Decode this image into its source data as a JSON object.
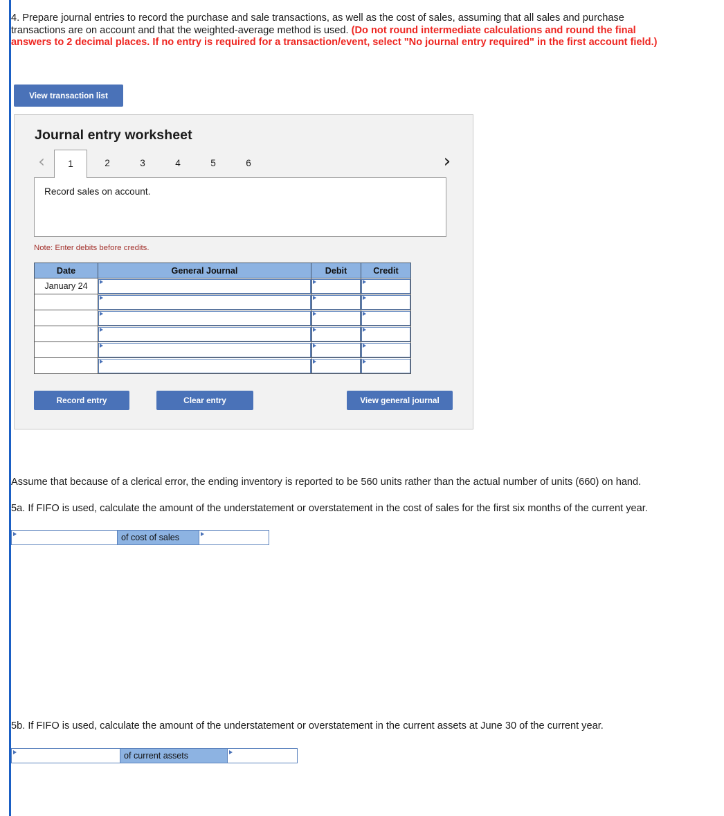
{
  "question4": {
    "plain_1": "4. Prepare journal entries to record the purchase and sale transactions, as well as the cost of sales, assuming that all sales and purchase transactions are on account and that the weighted-average method is used. ",
    "red_note": "(Do not round intermediate calculations and round the final answers to 2 decimal places. If no entry is required for a transaction/event, select \"No journal entry required\" in the first account field.)"
  },
  "buttons": {
    "view_transaction_list": "View transaction list",
    "record_entry": "Record entry",
    "clear_entry": "Clear entry",
    "view_general_journal": "View general journal"
  },
  "worksheet": {
    "title": "Journal entry worksheet",
    "prev_icon": "chevron-left",
    "next_icon": "chevron-right",
    "tabs": [
      {
        "label": "1",
        "active": true
      },
      {
        "label": "2",
        "active": false
      },
      {
        "label": "3",
        "active": false
      },
      {
        "label": "4",
        "active": false
      },
      {
        "label": "5",
        "active": false
      },
      {
        "label": "6",
        "active": false
      }
    ],
    "description": "Record sales on account.",
    "note": "Note: Enter debits before credits.",
    "table": {
      "headers": [
        "Date",
        "General Journal",
        "Debit",
        "Credit"
      ],
      "rows": [
        {
          "date": "January 24",
          "general_journal": "",
          "debit": "",
          "credit": ""
        },
        {
          "date": "",
          "general_journal": "",
          "debit": "",
          "credit": ""
        },
        {
          "date": "",
          "general_journal": "",
          "debit": "",
          "credit": ""
        },
        {
          "date": "",
          "general_journal": "",
          "debit": "",
          "credit": ""
        },
        {
          "date": "",
          "general_journal": "",
          "debit": "",
          "credit": ""
        },
        {
          "date": "",
          "general_journal": "",
          "debit": "",
          "credit": ""
        }
      ]
    }
  },
  "lower": {
    "assume_text": "Assume that because of a clerical error, the ending inventory is reported to be 560 units rather than the actual number of units (660) on hand.",
    "q5a": "5a. If FIFO is used, calculate the amount of the understatement or overstatement in the cost of sales for the first six months of the current year.",
    "q5a_answer": {
      "value1": "",
      "label": "of cost of sales",
      "value2": ""
    },
    "q5b": "5b. If FIFO is used, calculate the amount of the understatement or overstatement in the current assets at June 30 of the current year.",
    "q5b_answer": {
      "value1": "",
      "label": "of current assets",
      "value2": ""
    }
  },
  "colors": {
    "button_blue": "#4a72b8",
    "header_blue": "#8db3e2",
    "red_note": "#ee2722",
    "note_maroon": "#a3312c",
    "rail_blue": "#1a5fc4"
  }
}
